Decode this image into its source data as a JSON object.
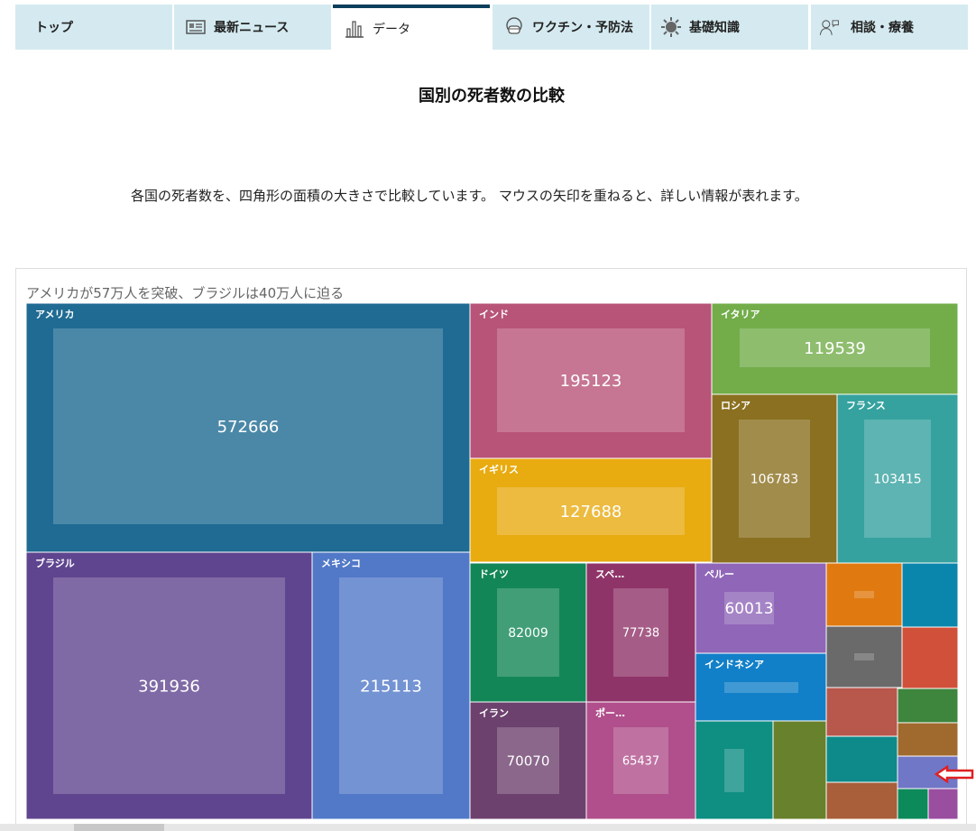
{
  "tabs": [
    {
      "label": "トップ",
      "icon": "none"
    },
    {
      "label": "最新ニュース",
      "icon": "newspaper-icon"
    },
    {
      "label": "データ",
      "icon": "bar-chart-icon"
    },
    {
      "label": "ワクチン・予防法",
      "icon": "mask-icon"
    },
    {
      "label": "基礎知識",
      "icon": "virus-icon"
    },
    {
      "label": "相談・療養",
      "icon": "consult-icon"
    }
  ],
  "page_title": "国別の死者数の比較",
  "description": "各国の死者数を、四角形の面積の大きさで比較しています。 マウスの矢印を重ねると、詳しい情報が表れます。",
  "chart_data": {
    "type": "treemap",
    "title": "アメリカが57万人を突破、ブラジルは40万人に迫る",
    "items": [
      {
        "name": "アメリカ",
        "value": 572666,
        "color": "#1f6b93",
        "label": "アメリカ",
        "value_label": "572666"
      },
      {
        "name": "ブラジル",
        "value": 391936,
        "color": "#5f458f",
        "label": "ブラジル",
        "value_label": "391936"
      },
      {
        "name": "メキシコ",
        "value": 215113,
        "color": "#5279c8",
        "label": "メキシコ",
        "value_label": "215113"
      },
      {
        "name": "インド",
        "value": 195123,
        "color": "#b85477",
        "label": "インド",
        "value_label": "195123"
      },
      {
        "name": "イギリス",
        "value": 127688,
        "color": "#e8ab10",
        "label": "イギリス",
        "value_label": "127688"
      },
      {
        "name": "イタリア",
        "value": 119539,
        "color": "#72ad4a",
        "label": "イタリア",
        "value_label": "119539"
      },
      {
        "name": "ロシア",
        "value": 106783,
        "color": "#8a7020",
        "label": "ロシア",
        "value_label": "106783"
      },
      {
        "name": "フランス",
        "value": 103415,
        "color": "#35a29f",
        "label": "フランス",
        "value_label": "103415"
      },
      {
        "name": "ドイツ",
        "value": 82009,
        "color": "#128656",
        "label": "ドイツ",
        "value_label": "82009"
      },
      {
        "name": "スペ…",
        "value": 77738,
        "color": "#8f3468",
        "label": "スペ…",
        "value_label": "77738"
      },
      {
        "name": "イラン",
        "value": 70070,
        "color": "#6d416e",
        "label": "イラン",
        "value_label": "70070"
      },
      {
        "name": "ポー…",
        "value": 65437,
        "color": "#b04f8b",
        "label": "ポー…",
        "value_label": "65437"
      },
      {
        "name": "ペルー",
        "value": 60013,
        "color": "#8f66b8",
        "label": "ペルー",
        "value_label": "60013"
      },
      {
        "name": "インドネシア",
        "value": null,
        "color": "#1280c8",
        "label": "インドネシア",
        "value_label": ""
      },
      {
        "name": "",
        "value": null,
        "color": "#0f8e82",
        "label": "",
        "value_label": ""
      },
      {
        "name": "",
        "value": null,
        "color": "#68812d",
        "label": "",
        "value_label": ""
      },
      {
        "name": "",
        "value": null,
        "color": "#e07a10",
        "label": "",
        "value_label": ""
      },
      {
        "name": "",
        "value": null,
        "color": "#0a86ad",
        "label": "",
        "value_label": ""
      },
      {
        "name": "",
        "value": null,
        "color": "#6a6a6a",
        "label": "",
        "value_label": ""
      },
      {
        "name": "",
        "value": null,
        "color": "#d0503a",
        "label": "",
        "value_label": ""
      },
      {
        "name": "",
        "value": null,
        "color": "#b8574c",
        "label": "",
        "value_label": ""
      },
      {
        "name": "",
        "value": null,
        "color": "#3e853e",
        "label": "",
        "value_label": ""
      },
      {
        "name": "",
        "value": null,
        "color": "#0e8a8a",
        "label": "",
        "value_label": ""
      },
      {
        "name": "",
        "value": null,
        "color": "#a06a2e",
        "label": "",
        "value_label": ""
      },
      {
        "name": "",
        "value": null,
        "color": "#a85f3a",
        "label": "",
        "value_label": ""
      },
      {
        "name": "",
        "value": null,
        "color": "#7077c6",
        "label": "",
        "value_label": ""
      },
      {
        "name": "",
        "value": null,
        "color": "#0d8a5a",
        "label": "",
        "value_label": ""
      },
      {
        "name": "",
        "value": null,
        "color": "#9a4ea0",
        "label": "",
        "value_label": ""
      }
    ],
    "pointer_color": "#e02020"
  }
}
